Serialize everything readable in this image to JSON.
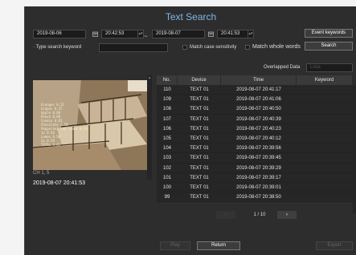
{
  "title": "Text Search",
  "from_date": "2019-08-06",
  "from_time": "20:42:53",
  "range_dash": "~",
  "to_date": "2019-08-07",
  "to_time": "20:41:53",
  "event_keywords_label": "Event keywords",
  "keyword_label": "Type search keyword",
  "keyword_value": "",
  "match_case_label": "Match case sensitivity",
  "match_whole_label": "Match whole words",
  "search_label": "Search",
  "overlapped_label": "Overlapped Data",
  "overlapped_value": "Lista",
  "channel": "CH 1, 5",
  "preview_timestamp": "2019-08-07 20:41:53",
  "preview_overlay": [
    "Oranges        0.52",
    "Grapes         0.25",
    "Apple          0.68",
    "Peach          0.98",
    "Cookie         0.62",
    "Chocolate      1.58",
    "Pepperoni red loose 0.59",
    "       1x 0.56",
    "Lemon          0.50",
    "       2x 0.59",
    "TOTAL          3.63"
  ],
  "table": {
    "headers": [
      "No.",
      "Device",
      "Time",
      "Keyword"
    ],
    "rows": [
      {
        "no": "110",
        "device": "TEXT 01",
        "time": "2019-08-07  20:41:17",
        "keyword": ""
      },
      {
        "no": "109",
        "device": "TEXT 01",
        "time": "2019-08-07  20:41:06",
        "keyword": ""
      },
      {
        "no": "108",
        "device": "TEXT 01",
        "time": "2019-08-07  20:40:50",
        "keyword": ""
      },
      {
        "no": "107",
        "device": "TEXT 01",
        "time": "2019-08-07  20:40:39",
        "keyword": ""
      },
      {
        "no": "106",
        "device": "TEXT 01",
        "time": "2019-08-07  20:40:23",
        "keyword": ""
      },
      {
        "no": "105",
        "device": "TEXT 01",
        "time": "2019-08-07  20:40:12",
        "keyword": ""
      },
      {
        "no": "104",
        "device": "TEXT 01",
        "time": "2019-08-07  20:39:56",
        "keyword": ""
      },
      {
        "no": "103",
        "device": "TEXT 01",
        "time": "2019-08-07  20:39:45",
        "keyword": ""
      },
      {
        "no": "102",
        "device": "TEXT 01",
        "time": "2019-08-07  20:39:29",
        "keyword": ""
      },
      {
        "no": "101",
        "device": "TEXT 01",
        "time": "2019-08-07  20:39:17",
        "keyword": ""
      },
      {
        "no": "100",
        "device": "TEXT 01",
        "time": "2019-08-07  20:39:01",
        "keyword": ""
      },
      {
        "no": "99",
        "device": "TEXT 01",
        "time": "2019-08-07  20:38:50",
        "keyword": ""
      }
    ]
  },
  "page_indicator": "1 / 10",
  "play_label": "Play",
  "return_label": "Return",
  "export_label": "Export"
}
